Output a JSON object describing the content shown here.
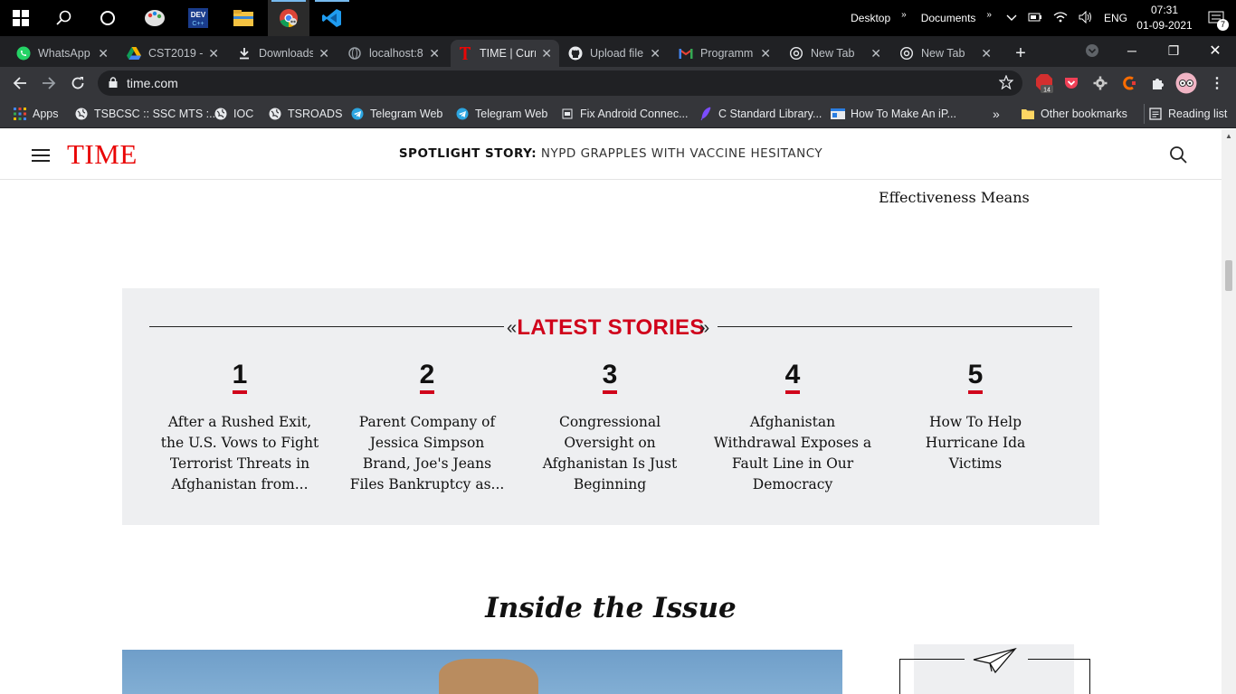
{
  "taskbar": {
    "desktop_label": "Desktop",
    "documents_label": "Documents",
    "language": "ENG",
    "time": "07:31",
    "date": "01-09-2021",
    "notification_count": "7"
  },
  "tabs": [
    {
      "title": "WhatsApp",
      "icon": "whatsapp-icon"
    },
    {
      "title": "CST2019 -",
      "icon": "google-drive-icon"
    },
    {
      "title": "Downloads",
      "icon": "download-icon"
    },
    {
      "title": "localhost:8",
      "icon": "globe-icon"
    },
    {
      "title": "TIME | Curr",
      "icon": "time-icon",
      "active": true
    },
    {
      "title": "Upload file",
      "icon": "github-icon"
    },
    {
      "title": "Programm",
      "icon": "gmail-icon"
    },
    {
      "title": "New Tab",
      "icon": "chrome-icon"
    },
    {
      "title": "New Tab",
      "icon": "chrome-icon"
    }
  ],
  "address_bar": {
    "url": "time.com"
  },
  "extensions": {
    "badge": "14"
  },
  "bookmarks": [
    {
      "label": "Apps"
    },
    {
      "label": "TSBCSC :: SSC MTS :..."
    },
    {
      "label": "IOC"
    },
    {
      "label": "TSROADS"
    },
    {
      "label": "Telegram Web"
    },
    {
      "label": "Telegram Web"
    },
    {
      "label": "Fix Android Connec..."
    },
    {
      "label": "C Standard Library..."
    },
    {
      "label": "How To Make An iP..."
    }
  ],
  "bookmarks_more": "»",
  "other_bookmarks": "Other bookmarks",
  "reading_list": "Reading list",
  "site": {
    "logo": "TIME",
    "spotlight_label": "SPOTLIGHT STORY:",
    "spotlight_title": "NYPD GRAPPLES WITH VACCINE HESITANCY",
    "previous_headline": "Effectiveness Means",
    "latest_title": "LATEST STORIES",
    "stories": [
      {
        "number": "1",
        "headline": "After a Rushed Exit, the U.S. Vows to Fight Terrorist Threats in Afghanistan from..."
      },
      {
        "number": "2",
        "headline": "Parent Company of Jessica Simpson Brand, Joe's Jeans Files Bankruptcy as..."
      },
      {
        "number": "3",
        "headline": "Congressional Oversight on Afghanistan Is Just Beginning"
      },
      {
        "number": "4",
        "headline": "Afghanistan Withdrawal Exposes a Fault Line in Our Democracy"
      },
      {
        "number": "5",
        "headline": "How To Help Hurricane Ida Victims"
      }
    ],
    "inside_issue": "Inside the Issue"
  }
}
